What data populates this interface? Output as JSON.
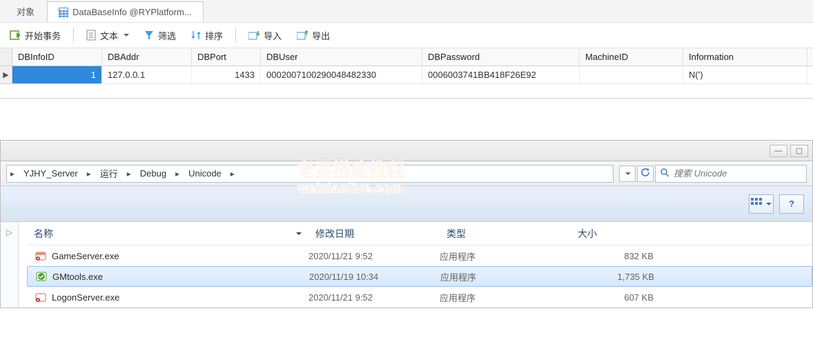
{
  "db": {
    "tabs": {
      "inactive": "对象",
      "active": "DataBaseInfo @RYPlatform..."
    },
    "toolbar": {
      "begin_tx": "开始事务",
      "text": "文本",
      "filter": "筛选",
      "sort": "排序",
      "import": "导入",
      "export": "导出"
    },
    "grid": {
      "headers": {
        "c1": "DBInfoID",
        "c2": "DBAddr",
        "c3": "DBPort",
        "c4": "DBUser",
        "c5": "DBPassword",
        "c6": "MachineID",
        "c7": "Information"
      },
      "row": {
        "c1": "1",
        "c2": "127.0.0.1",
        "c3": "1433",
        "c4": "0002007100290048482330",
        "c5": "0006003741BB418F26E92",
        "c6": "",
        "c7": "N(')"
      }
    }
  },
  "explorer": {
    "breadcrumbs": {
      "p1": "YJHY_Server",
      "p2": "运行",
      "p3": "Debug",
      "p4": "Unicode"
    },
    "search_placeholder": "搜索 Unicode",
    "headers": {
      "name": "名称",
      "modified": "修改日期",
      "type": "类型",
      "size": "大小"
    },
    "files": [
      {
        "name": "GameServer.exe",
        "modified": "2020/11/21 9:52",
        "type": "应用程序",
        "size": "832 KB",
        "selected": false
      },
      {
        "name": "GMtools.exe",
        "modified": "2020/11/19 10:34",
        "type": "应用程序",
        "size": "1,735 KB",
        "selected": true
      },
      {
        "name": "LogonServer.exe",
        "modified": "2020/11/21 9:52",
        "type": "应用程序",
        "size": "607 KB",
        "selected": false
      }
    ]
  },
  "watermark": {
    "line1": "老吴搭建教程",
    "line2": "weixiaolive.com"
  }
}
